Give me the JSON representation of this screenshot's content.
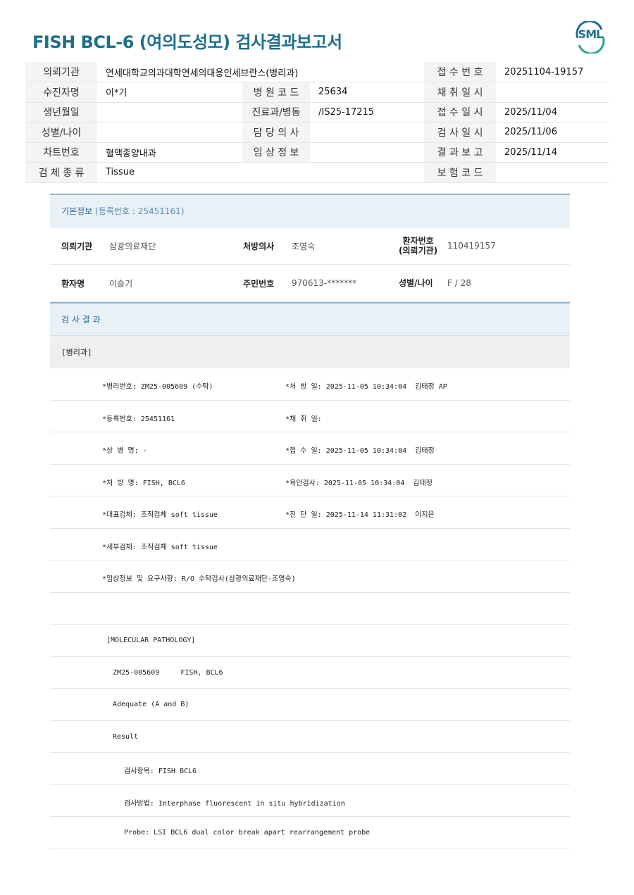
{
  "title": "FISH BCL-6 (여의도성모) 검사결과보고서",
  "logo": "SML",
  "colors": {
    "title": "#1f6f8b",
    "section_head_bg": "#e9f1f7",
    "label_bg": "#f3f4f5"
  },
  "header": {
    "rows": [
      [
        {
          "label": "의뢰기관",
          "value": "연세대학교의과대학연세의대용인세브란스(병리과)"
        },
        null,
        {
          "label": "접 수 번 호",
          "value": "20251104-19157"
        }
      ],
      [
        {
          "label": "수진자명",
          "value": "이*기"
        },
        {
          "label": "병 원 코 드",
          "value": "25634"
        },
        {
          "label": "채 취 일 시",
          "value": ""
        }
      ],
      [
        {
          "label": "생년월일",
          "value": ""
        },
        {
          "label": "진료과/병동",
          "value": "/IS25-17215"
        },
        {
          "label": "접 수 일 시",
          "value": "2025/11/04"
        }
      ],
      [
        {
          "label": "성별/나이",
          "value": ""
        },
        {
          "label": "담 당 의 사",
          "value": ""
        },
        {
          "label": "검 사 일 시",
          "value": "2025/11/06"
        }
      ],
      [
        {
          "label": "차트번호",
          "value": "혈액종양내과"
        },
        {
          "label": "임 상 정 보",
          "value": ""
        },
        {
          "label": "결 과 보 고",
          "value": "2025/11/14"
        }
      ],
      [
        {
          "label": "검 체 종 류",
          "value": "Tissue"
        },
        null,
        {
          "label": "보 험 코 드",
          "value": ""
        }
      ]
    ]
  },
  "basic_info": {
    "heading": "기본정보",
    "reg_no": "(등록번호 : 25451161)",
    "row1": {
      "l1": "의뢰기관",
      "v1": "삼광의료재단",
      "l2": "처방의사",
      "v2": "조영숙",
      "l3a": "환자번호",
      "l3b": "(의뢰기관)",
      "v3": "110419157"
    },
    "row2": {
      "l1": "환자명",
      "v1": "이슬기",
      "l2": "주민번호",
      "v2": "970613-*******",
      "l3": "성별/나이",
      "v3": "F / 28"
    }
  },
  "results": {
    "heading": "검 사 결 과",
    "dept": "[병리과]",
    "lines": [
      {
        "a": "*병리번호: ZM25-005609 (수탁)",
        "b": "*처 방 일: 2025-11-05 10:34:04  김태정 AP"
      },
      {
        "a": "*등록번호: 25451161",
        "b": "*채 취 일:"
      },
      {
        "a": "*상 병 명: -",
        "b": "*접 수 일: 2025-11-05 10:34:04  김태정"
      },
      {
        "a": "*처 방 명: FISH, BCL6",
        "b": "*육안검사: 2025-11-05 10:34:04  김태정"
      },
      {
        "a": "*대표검체: 조직검체 soft tissue",
        "b": "*진 단 일: 2025-11-14 11:31:02  이지은"
      },
      {
        "a": "*세부검체: 조직검체 soft tissue",
        "b": ""
      },
      {
        "a": "*임상정보 및 요구사항: R/O 수탁검사(삼광의료재단-조영숙)",
        "b": ""
      }
    ],
    "molecular": {
      "heading": "[MOLECULAR PATHOLOGY]",
      "case": "ZM25-005609     FISH, BCL6",
      "adequacy": "Adequate (A and B)",
      "result": "Result",
      "item": "검사항목: FISH BCL6",
      "method": "검사방법: Interphase fluorescent in situ hybridization",
      "probe": "Probe: LSI BCL6 dual color break apart rearrangement probe"
    }
  }
}
